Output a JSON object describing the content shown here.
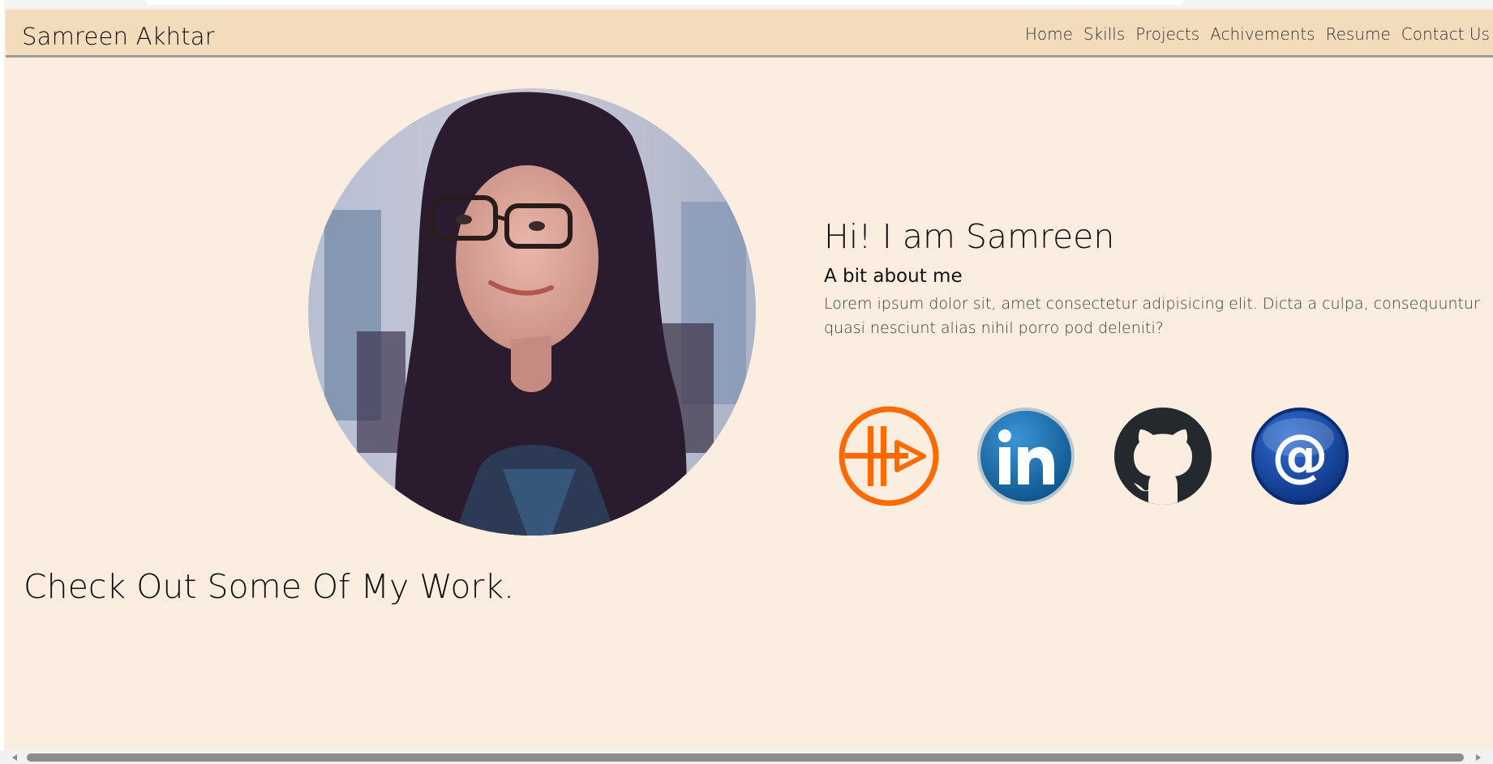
{
  "header": {
    "brand": "Samreen Akhtar",
    "nav": [
      "Home",
      "Skills",
      "Projects",
      "Achivements",
      "Resume",
      "Contact Us"
    ]
  },
  "hero": {
    "greeting": "Hi! I am Samreen",
    "subheading": "A bit about me",
    "bio": "Lorem ipsum dolor sit, amet consectetur adipisicing elit. Dicta a culpa, consequuntur quasi nesciunt alias nihil porro pod deleniti?",
    "photo_icon": "profile-photo"
  },
  "socials": [
    {
      "name": "hashnode",
      "icon": "hashnode-icon",
      "color": "#ff6a00"
    },
    {
      "name": "linkedin",
      "icon": "linkedin-icon",
      "color": "#0e5a94"
    },
    {
      "name": "github",
      "icon": "github-icon",
      "color": "#24292e"
    },
    {
      "name": "email",
      "icon": "at-sign-icon",
      "color": "#0b3d91"
    }
  ],
  "work": {
    "title": "Check Out Some Of My Work."
  },
  "colors": {
    "background": "#fbeee0",
    "navbar": "#f3dcbc",
    "navbar_border": "#9a9a9a"
  }
}
